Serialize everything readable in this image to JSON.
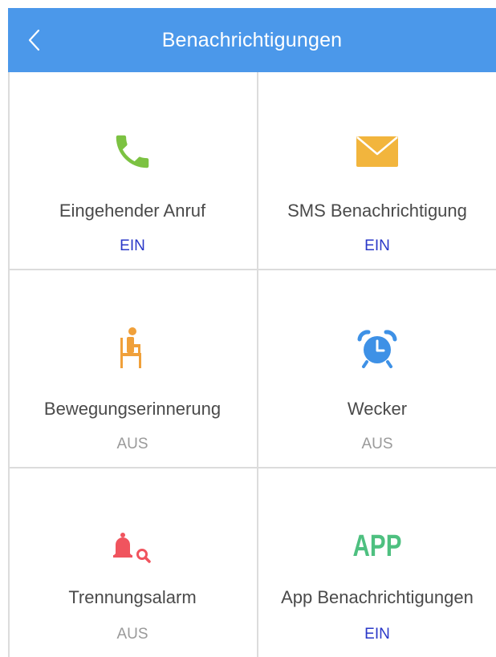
{
  "header": {
    "title": "Benachrichtigungen",
    "back_icon": "chevron-left-icon"
  },
  "tiles": [
    {
      "label": "Eingehender Anruf",
      "state": "EIN",
      "icon": "phone-icon",
      "color": "#7cc242"
    },
    {
      "label": "SMS Benachrichtigung",
      "state": "EIN",
      "icon": "envelope-icon",
      "color": "#f2b53d"
    },
    {
      "label": "Bewegungserinnerung",
      "state": "AUS",
      "icon": "sitting-person-icon",
      "color": "#f0a03a"
    },
    {
      "label": "Wecker",
      "state": "AUS",
      "icon": "alarm-clock-icon",
      "color": "#3e91e6"
    },
    {
      "label": "Trennungsalarm",
      "state": "AUS",
      "icon": "bell-search-icon",
      "color": "#f0545e"
    },
    {
      "label": "App Benachrichtigungen",
      "state": "EIN",
      "icon": "app-text-icon",
      "icon_text": "APP",
      "color": "#4ec080"
    }
  ],
  "colors": {
    "header": "#4b98ea",
    "on": "#2a38c8",
    "off": "#9a9a9a"
  }
}
